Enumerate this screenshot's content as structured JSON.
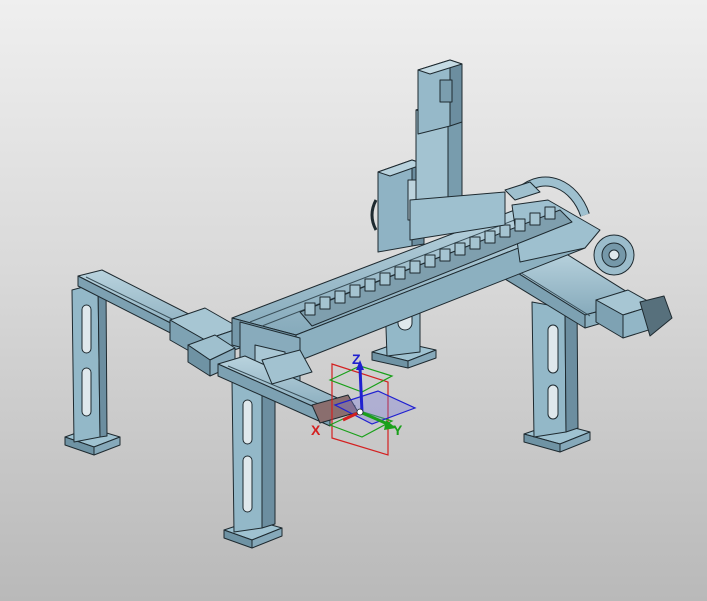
{
  "viewport": {
    "background_top": "#efefef",
    "background_bottom": "#b9b9b9",
    "model_color": "#8fb3c4",
    "model_dark": "#5f7e8d",
    "model_light": "#b9d3de",
    "edge_color": "#1e2a30"
  },
  "triad": {
    "x_label": "X",
    "y_label": "Y",
    "z_label": "Z",
    "x_color": "#d42020",
    "y_color": "#1aa01a",
    "z_color": "#2020d0",
    "icon": "coordinate-triad-icon"
  }
}
